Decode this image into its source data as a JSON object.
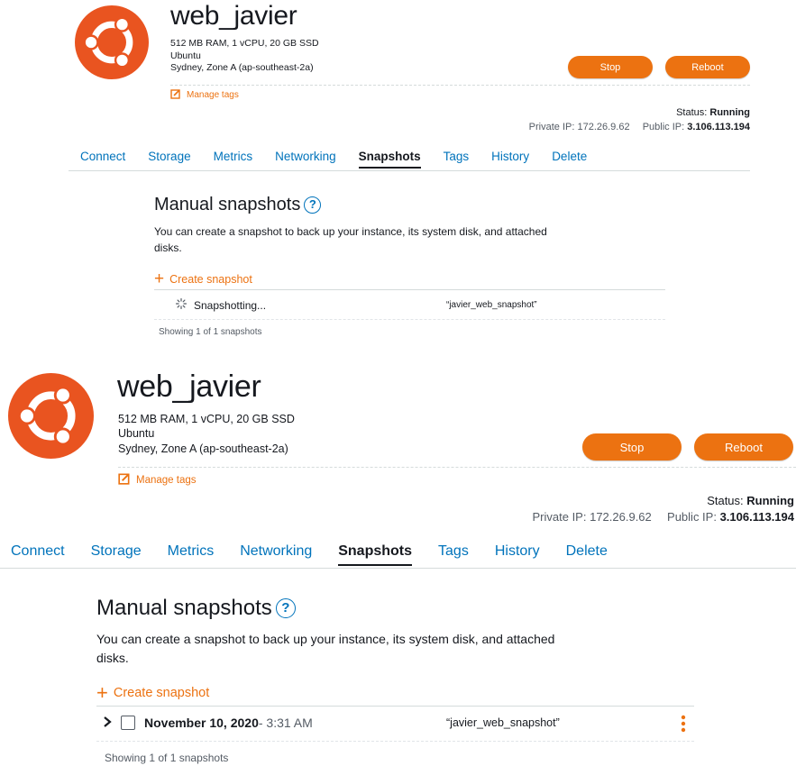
{
  "colors": {
    "accent": "#ec7211",
    "link": "#0073bb",
    "ubuntu": "#e95420",
    "text": "#16191f",
    "muted": "#545b64"
  },
  "instance": {
    "name": "web_javier",
    "specs": "512 MB RAM, 1 vCPU, 20 GB SSD",
    "os": "Ubuntu",
    "location": "Sydney, Zone A (ap-southeast-2a)",
    "manage_tags_label": "Manage tags",
    "stop_label": "Stop",
    "reboot_label": "Reboot",
    "status_label": "Status:",
    "status_value": "Running",
    "private_ip_label": "Private IP:",
    "private_ip": "172.26.9.62",
    "public_ip_label": "Public IP:",
    "public_ip": "3.106.113.194"
  },
  "tabs": [
    "Connect",
    "Storage",
    "Metrics",
    "Networking",
    "Snapshots",
    "Tags",
    "History",
    "Delete"
  ],
  "active_tab": "Snapshots",
  "snapshots_section": {
    "title": "Manual snapshots",
    "help_glyph": "?",
    "description_line1": "You can create a snapshot to back up your instance, its system disk, and attached",
    "description_line2": "disks.",
    "create_label": "Create snapshot",
    "showing": "Showing 1 of 1 snapshots"
  },
  "top_panel": {
    "row_status": "Snapshotting...",
    "row_name": "“javier_web_snapshot”"
  },
  "bottom_panel": {
    "row_date": "November 10, 2020",
    "row_time": " - 3:31 AM",
    "row_name": "“javier_web_snapshot”"
  },
  "icons": [
    "ubuntu-logo-icon",
    "edit-tag-icon",
    "help-icon",
    "plus-icon",
    "spinner-icon",
    "chevron-right-icon",
    "checkbox-icon",
    "kebab-menu-icon"
  ]
}
